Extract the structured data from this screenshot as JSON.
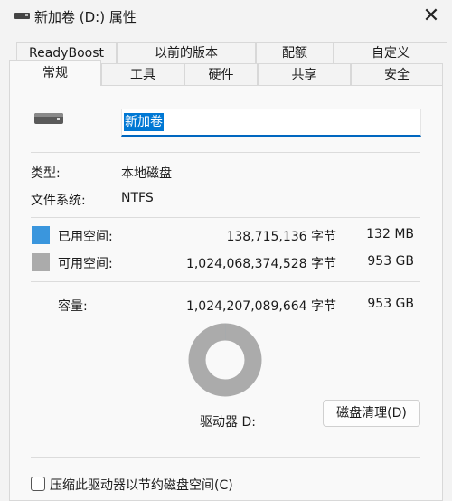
{
  "window": {
    "title": "新加卷 (D:) 属性",
    "close_glyph": "✕"
  },
  "tabs": {
    "row1": [
      "ReadyBoost",
      "以前的版本",
      "配额",
      "自定义"
    ],
    "row2": [
      "常规",
      "工具",
      "硬件",
      "共享",
      "安全"
    ],
    "active": "常规"
  },
  "general": {
    "volume_name": "新加卷",
    "type_label": "类型:",
    "type_value": "本地磁盘",
    "fs_label": "文件系统:",
    "fs_value": "NTFS",
    "used": {
      "label": "已用空间:",
      "bytes": "138,715,136 字节",
      "size": "132 MB",
      "color": "#3a96dd"
    },
    "free": {
      "label": "可用空间:",
      "bytes": "1,024,068,374,528 字节",
      "size": "953 GB",
      "color": "#ababab"
    },
    "capacity": {
      "label": "容量:",
      "bytes": "1,024,207,089,664 字节",
      "size": "953 GB"
    },
    "used_fraction": 0.000135,
    "drive_label": "驱动器 D:",
    "cleanup_button": "磁盘清理(D)",
    "compress_checkbox": "压缩此驱动器以节约磁盘空间(C)",
    "compress_checked": false
  }
}
